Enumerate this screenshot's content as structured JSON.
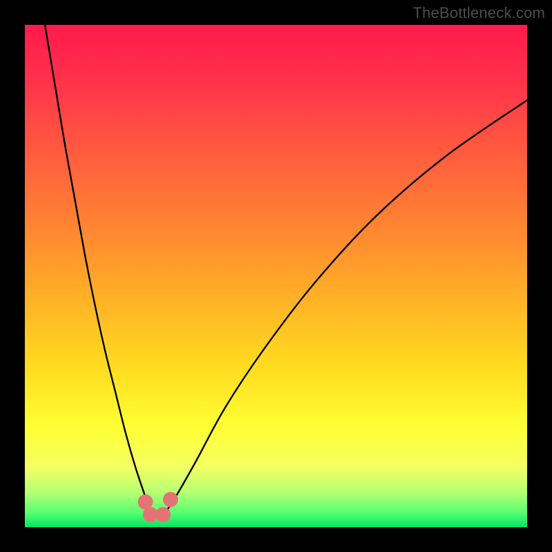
{
  "watermark": {
    "text": "TheBottleneck.com"
  },
  "chart_data": {
    "type": "line",
    "title": "",
    "xlabel": "",
    "ylabel": "",
    "xlim": [
      0,
      100
    ],
    "ylim": [
      0,
      100
    ],
    "grid": false,
    "legend": "none",
    "background_gradient": [
      {
        "pos": 0,
        "color": "#ff1a4d"
      },
      {
        "pos": 25,
        "color": "#ff5a3f"
      },
      {
        "pos": 55,
        "color": "#ffb326"
      },
      {
        "pos": 80,
        "color": "#ffff33"
      },
      {
        "pos": 100,
        "color": "#00e765"
      }
    ],
    "series": [
      {
        "name": "bottleneck-curve",
        "x": [
          4,
          6,
          8,
          10,
          12,
          14,
          16,
          18,
          20,
          22,
          24,
          25,
          26,
          27,
          28,
          30,
          34,
          40,
          48,
          58,
          70,
          84,
          100
        ],
        "values": [
          100,
          88,
          76,
          65,
          54,
          44,
          35,
          27,
          19,
          12,
          6,
          3,
          2,
          2,
          3,
          6,
          13,
          24,
          36,
          49,
          62,
          74,
          85
        ]
      }
    ],
    "markers": [
      {
        "name": "trough-left",
        "x": 24.0,
        "y": 5.0
      },
      {
        "name": "trough-mid-l",
        "x": 25.0,
        "y": 2.5
      },
      {
        "name": "trough-mid-r",
        "x": 27.5,
        "y": 2.5
      },
      {
        "name": "trough-right",
        "x": 29.0,
        "y": 5.5
      }
    ],
    "marker_style": {
      "radius_px": 11,
      "fill": "#e57373"
    }
  }
}
